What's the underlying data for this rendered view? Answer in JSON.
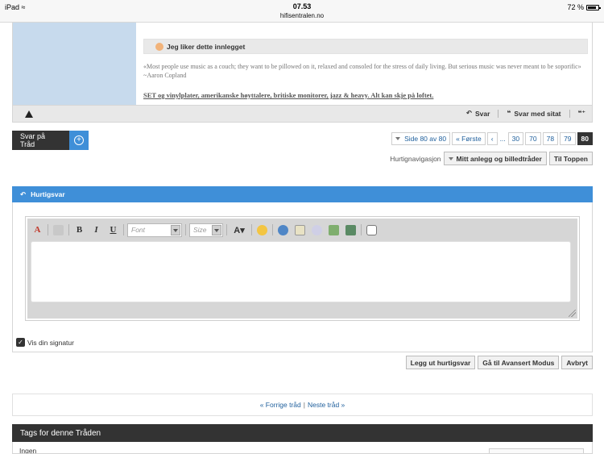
{
  "statusbar": {
    "device": "iPad",
    "time": "07.53",
    "url": "hifisentralen.no",
    "battery": "72 %"
  },
  "post": {
    "like_text": "Jeg liker dette innlegget",
    "quote": "«Most people use music as a couch; they want to be pillowed on it, relaxed and consoled for the stress of daily living. But serious music was never meant to be soporific» ~Aaron Copland",
    "signature": "SET og vinylplater, amerikanske høyttalere, britiske monitorer, jazz & heavy. Alt kan skje på loftet.",
    "actions": {
      "reply": "Svar",
      "reply_quote": "Svar med sitat"
    }
  },
  "reply_thread": {
    "label": "Svar på Tråd"
  },
  "pagination": {
    "page_of": "Side 80 av 80",
    "first": "Første",
    "ellipsis": "...",
    "pages": [
      "30",
      "70",
      "78",
      "79",
      "80"
    ],
    "current": "80"
  },
  "quicknav": {
    "label": "Hurtignavigasjon",
    "dropdown": "Mitt anlegg og billedtråder",
    "top_button": "Til Toppen"
  },
  "quick_reply": {
    "title": "Hurtigsvar",
    "font_placeholder": "Font",
    "size_placeholder": "Size",
    "signature_label": "Vis din signatur",
    "post_button": "Legg ut hurtigsvar",
    "advanced_button": "Gå til Avansert Modus",
    "cancel_button": "Avbryt"
  },
  "prevnext": {
    "prev": "« Forrige tråd",
    "separator": "|",
    "next": "Neste tråd »"
  },
  "tags": {
    "title": "Tags for denne Tråden",
    "none": "Ingen"
  },
  "colors": {
    "accent": "#3f8fd8",
    "dark": "#333333",
    "link": "#1f5f9c",
    "side": "#c7daed"
  }
}
